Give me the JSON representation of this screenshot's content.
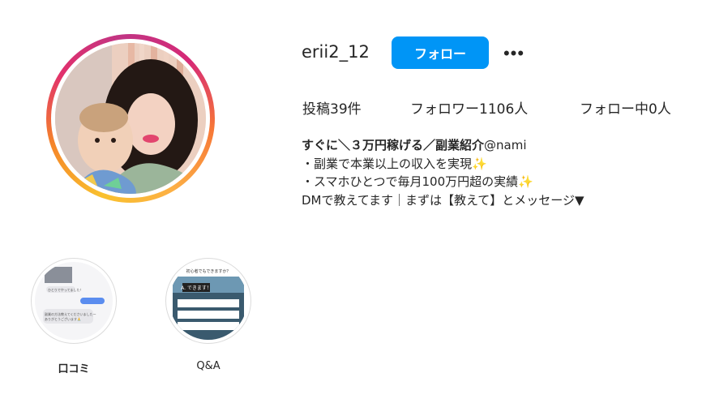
{
  "profile": {
    "username": "erii2_12",
    "follow_label": "フォロー",
    "more_label": "•••"
  },
  "stats": {
    "posts": "投稿39件",
    "followers": "フォロワー1106人",
    "following": "フォロー中0人"
  },
  "bio": {
    "name": "すぐに＼３万円稼げる／副業紹介",
    "handle": "@nami",
    "line1": "・副業で本業以上の収入を実現",
    "line2": "・スマホひとつで毎月100万円超の実績",
    "line3": "DMで教えてます｜まずは【教えて】とメッセージ▼",
    "sparkle": "✨"
  },
  "highlights": [
    {
      "label": "口コミ",
      "thumb_texts": [
        "ひとりでやってました！",
        "副業の方法教えてくださいましたー",
        "ありがとうございます🙏"
      ]
    },
    {
      "label": "Q&A",
      "thumb_texts": [
        "初心者でもできますか？",
        "A. できます！"
      ]
    }
  ],
  "colors": {
    "accent": "#0095f6",
    "text": "#262626",
    "ring_start": "#f9c12e",
    "ring_end": "#c13584"
  }
}
